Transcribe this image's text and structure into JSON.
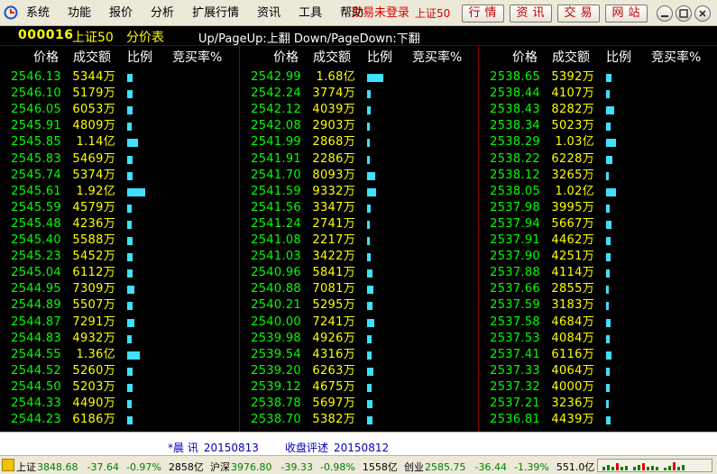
{
  "window": {
    "menu": [
      "系统",
      "功能",
      "报价",
      "分析",
      "扩展行情",
      "资讯",
      "工具",
      "帮助"
    ],
    "trade_status": "交易未登录",
    "index_name": "上证50",
    "quick_buttons": [
      "行情",
      "资讯",
      "交易",
      "网站"
    ]
  },
  "info": {
    "code": "000016",
    "name": "上证50",
    "view_title": "分价表",
    "page_hint": "Up/PageUp:上翻 Down/PageDown:下翻"
  },
  "table": {
    "headers": {
      "price": "价格",
      "amount": "成交额",
      "ratio": "比例",
      "buy_rate": "竞买率%"
    },
    "columns": [
      [
        {
          "price": "2546.13",
          "amount": "5344万",
          "ratio": 0.3
        },
        {
          "price": "2546.10",
          "amount": "5179万",
          "ratio": 0.29
        },
        {
          "price": "2546.05",
          "amount": "6053万",
          "ratio": 0.33
        },
        {
          "price": "2545.91",
          "amount": "4809万",
          "ratio": 0.27
        },
        {
          "price": "2545.85",
          "amount": "1.14亿",
          "ratio": 0.63
        },
        {
          "price": "2545.83",
          "amount": "5469万",
          "ratio": 0.3
        },
        {
          "price": "2545.74",
          "amount": "5374万",
          "ratio": 0.3
        },
        {
          "price": "2545.61",
          "amount": "1.92亿",
          "ratio": 1.07
        },
        {
          "price": "2545.59",
          "amount": "4579万",
          "ratio": 0.25
        },
        {
          "price": "2545.48",
          "amount": "4236万",
          "ratio": 0.24
        },
        {
          "price": "2545.40",
          "amount": "5588万",
          "ratio": 0.31
        },
        {
          "price": "2545.23",
          "amount": "5452万",
          "ratio": 0.3
        },
        {
          "price": "2545.04",
          "amount": "6112万",
          "ratio": 0.34
        },
        {
          "price": "2544.95",
          "amount": "7309万",
          "ratio": 0.41
        },
        {
          "price": "2544.89",
          "amount": "5507万",
          "ratio": 0.31
        },
        {
          "price": "2544.87",
          "amount": "7291万",
          "ratio": 0.41
        },
        {
          "price": "2544.83",
          "amount": "4932万",
          "ratio": 0.27
        },
        {
          "price": "2544.55",
          "amount": "1.36亿",
          "ratio": 0.76
        },
        {
          "price": "2544.52",
          "amount": "5260万",
          "ratio": 0.29
        },
        {
          "price": "2544.50",
          "amount": "5203万",
          "ratio": 0.29
        },
        {
          "price": "2544.33",
          "amount": "4490万",
          "ratio": 0.25
        },
        {
          "price": "2544.23",
          "amount": "6186万",
          "ratio": 0.34
        }
      ],
      [
        {
          "price": "2542.99",
          "amount": "1.68亿",
          "ratio": 0.93
        },
        {
          "price": "2542.24",
          "amount": "3774万",
          "ratio": 0.21
        },
        {
          "price": "2542.12",
          "amount": "4039万",
          "ratio": 0.22
        },
        {
          "price": "2542.08",
          "amount": "2903万",
          "ratio": 0.16
        },
        {
          "price": "2541.99",
          "amount": "2868万",
          "ratio": 0.16
        },
        {
          "price": "2541.91",
          "amount": "2286万",
          "ratio": 0.13
        },
        {
          "price": "2541.70",
          "amount": "8093万",
          "ratio": 0.45
        },
        {
          "price": "2541.59",
          "amount": "9332万",
          "ratio": 0.52
        },
        {
          "price": "2541.56",
          "amount": "3347万",
          "ratio": 0.19
        },
        {
          "price": "2541.24",
          "amount": "2741万",
          "ratio": 0.15
        },
        {
          "price": "2541.08",
          "amount": "2217万",
          "ratio": 0.12
        },
        {
          "price": "2541.03",
          "amount": "3422万",
          "ratio": 0.19
        },
        {
          "price": "2540.96",
          "amount": "5841万",
          "ratio": 0.32
        },
        {
          "price": "2540.88",
          "amount": "7081万",
          "ratio": 0.39
        },
        {
          "price": "2540.21",
          "amount": "5295万",
          "ratio": 0.29
        },
        {
          "price": "2540.00",
          "amount": "7241万",
          "ratio": 0.4
        },
        {
          "price": "2539.98",
          "amount": "4926万",
          "ratio": 0.27
        },
        {
          "price": "2539.54",
          "amount": "4316万",
          "ratio": 0.24
        },
        {
          "price": "2539.20",
          "amount": "6263万",
          "ratio": 0.35
        },
        {
          "price": "2539.12",
          "amount": "4675万",
          "ratio": 0.26
        },
        {
          "price": "2538.78",
          "amount": "5697万",
          "ratio": 0.32
        },
        {
          "price": "2538.70",
          "amount": "5382万",
          "ratio": 0.3
        }
      ],
      [
        {
          "price": "2538.65",
          "amount": "5392万",
          "ratio": 0.3
        },
        {
          "price": "2538.44",
          "amount": "4107万",
          "ratio": 0.23
        },
        {
          "price": "2538.43",
          "amount": "8282万",
          "ratio": 0.46
        },
        {
          "price": "2538.34",
          "amount": "5023万",
          "ratio": 0.28
        },
        {
          "price": "2538.29",
          "amount": "1.03亿",
          "ratio": 0.57
        },
        {
          "price": "2538.22",
          "amount": "6228万",
          "ratio": 0.35
        },
        {
          "price": "2538.12",
          "amount": "3265万",
          "ratio": 0.18
        },
        {
          "price": "2538.05",
          "amount": "1.02亿",
          "ratio": 0.57
        },
        {
          "price": "2537.98",
          "amount": "3995万",
          "ratio": 0.22
        },
        {
          "price": "2537.94",
          "amount": "5667万",
          "ratio": 0.32
        },
        {
          "price": "2537.91",
          "amount": "4462万",
          "ratio": 0.25
        },
        {
          "price": "2537.90",
          "amount": "4251万",
          "ratio": 0.24
        },
        {
          "price": "2537.88",
          "amount": "4114万",
          "ratio": 0.23
        },
        {
          "price": "2537.66",
          "amount": "2855万",
          "ratio": 0.16
        },
        {
          "price": "2537.59",
          "amount": "3183万",
          "ratio": 0.18
        },
        {
          "price": "2537.58",
          "amount": "4684万",
          "ratio": 0.26
        },
        {
          "price": "2537.53",
          "amount": "4084万",
          "ratio": 0.23
        },
        {
          "price": "2537.41",
          "amount": "6116万",
          "ratio": 0.34
        },
        {
          "price": "2537.33",
          "amount": "4064万",
          "ratio": 0.23
        },
        {
          "price": "2537.32",
          "amount": "4000万",
          "ratio": 0.22
        },
        {
          "price": "2537.21",
          "amount": "3236万",
          "ratio": 0.18
        },
        {
          "price": "2536.81",
          "amount": "4439万",
          "ratio": 0.25
        }
      ]
    ],
    "bar_color": "#40e0ff"
  },
  "news": {
    "item1_title": "*晨 讯",
    "item1_date": "20150813",
    "item2_title": "收盘评述",
    "item2_date": "20150812"
  },
  "statusbar": {
    "indexes": [
      {
        "name": "上证",
        "value": "3848.68",
        "change": "-37.64",
        "pct": "-0.97%",
        "volume": "2858亿"
      },
      {
        "name": "沪深",
        "value": "3976.80",
        "change": "-39.33",
        "pct": "-0.98%",
        "volume": "1558亿"
      },
      {
        "name": "创业",
        "value": "2585.75",
        "change": "-36.44",
        "pct": "-1.39%",
        "volume": "551.0亿"
      }
    ]
  },
  "icons": {
    "logo": "app-logo-icon",
    "minimize": "minimize-icon",
    "restore": "restore-icon",
    "close": "close-icon",
    "status": "status-indicator-icon"
  }
}
